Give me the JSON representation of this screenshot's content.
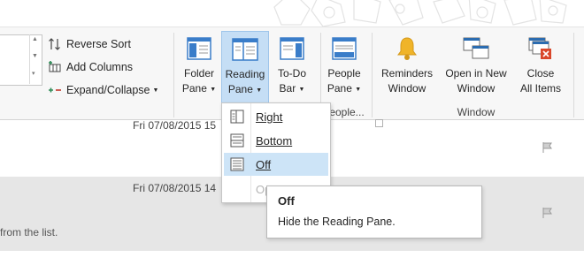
{
  "ribbon": {
    "arrangement_commands": [
      {
        "label": "Reverse Sort",
        "icon": "reverse-sort-icon"
      },
      {
        "label": "Add Columns",
        "icon": "add-columns-icon"
      },
      {
        "label": "Expand/Collapse",
        "icon": "expand-collapse-icon"
      }
    ],
    "buttons": {
      "folder_pane": {
        "line1": "Folder",
        "line2": "Pane"
      },
      "reading_pane": {
        "line1": "Reading",
        "line2": "Pane"
      },
      "todo_bar": {
        "line1": "To-Do",
        "line2": "Bar"
      },
      "people_pane": {
        "line1": "People",
        "line2": "Pane"
      },
      "reminders_window": {
        "line1": "Reminders",
        "line2": "Window"
      },
      "open_new_window": {
        "line1": "Open in New",
        "line2": "Window"
      },
      "close_all_items": {
        "line1": "Close",
        "line2": "All Items"
      }
    },
    "groups": {
      "people": "eople...",
      "window": "Window"
    }
  },
  "reading_pane_menu": {
    "items": [
      {
        "label": "Right",
        "icon": "reading-pane-right-icon",
        "state": "normal"
      },
      {
        "label": "Bottom",
        "icon": "reading-pane-bottom-icon",
        "state": "normal"
      },
      {
        "label": "Off",
        "icon": "reading-pane-off-icon",
        "state": "hover"
      },
      {
        "label": "Op",
        "state": "disabled"
      }
    ]
  },
  "tooltip": {
    "title": "Off",
    "description": "Hide the Reading Pane."
  },
  "messages": [
    {
      "date": "Fri 07/08/2015 15"
    },
    {
      "date": "Fri 07/08/2015 14",
      "snippet": "from the list."
    }
  ],
  "colors": {
    "active_button": "#c5def5",
    "menu_hover": "#cde4f7",
    "selected_row": "#e6e6e6",
    "bell": "#f0b429",
    "close_red": "#d9472b",
    "window_blue": "#2b6cb0"
  }
}
